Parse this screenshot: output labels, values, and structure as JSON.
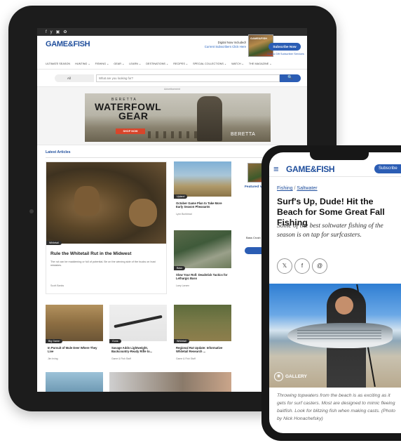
{
  "tablet": {
    "social_icons": [
      "f",
      "y",
      "▣",
      "✿"
    ],
    "logo": "GAME&FISH",
    "digital_line1": "Digital Now Included!",
    "digital_line2": "Current Subscribers Click Here",
    "mag_label": "GAME&FISH",
    "subscribe_label": "Subscribe Now",
    "header_links": "Give a Gift   Subscriber Services",
    "nav_items": [
      "ULTIMATE SEASON",
      "HUNTING ⌄",
      "FISHING ⌄",
      "GEAR ⌄",
      "LEARN ⌄",
      "DESTINATIONS ⌄",
      "RECIPES ⌄",
      "SPECIAL COLLECTIONS ⌄",
      "WATCH ⌄",
      "THE MAGAZINE ⌄"
    ],
    "search_category": "All",
    "search_placeholder": "What are you looking for?",
    "search_button": "🔍",
    "ad_label": "Advertisement",
    "ad_brand_small": "BERETTA",
    "ad_line1": "WATERFOWL",
    "ad_line2": "GEAR",
    "ad_button": "SHOP NOW",
    "ad_brand_mark": "BERETTA",
    "section_title": "Latest Articles",
    "main_article": {
      "tag": "Whitetail",
      "title": "Rule the Whitetail Rut in the Midwest",
      "description": "The rut can be maddening or full of potential. Be on the winning side of the bucks on bust mistakes.",
      "byline": "Scott Banks"
    },
    "right_cards": [
      {
        "tag": "Upland",
        "title": "October Game Plan to Take More Early Season Pheasants",
        "byline": "Lynn Burkhead"
      },
      {
        "tag": "Bass",
        "title": "Slow Your Roll: Deadstick Tactics for Lethargic Bass",
        "byline": "Larry Larsen"
      }
    ],
    "bottom_cards": [
      {
        "tag": "Big Game",
        "title": "In Pursuit of Mule Deer Where They Live",
        "byline": "Jim Irving"
      },
      {
        "tag": "Guns",
        "title": "Savage Adds Lightweight, Backcountry-Ready Rifle to...",
        "byline": "Game & Fish Staff"
      },
      {
        "tag": "Whitetail",
        "title": "Regional Rut Update: Informative Whitetail Research ...",
        "byline": "Game & Fish Staff"
      }
    ],
    "side_column": {
      "featured_label": "Featured Vide",
      "promo_title": "Bass Crush Coun Bladed Jigs",
      "see_label": "See"
    }
  },
  "phone": {
    "menu_icon": "≡",
    "logo": "GAME&FISH",
    "subscribe_label": "Subscribe",
    "crumb_1": "Fishing",
    "crumb_sep": " / ",
    "crumb_2": "Saltwater",
    "title": "Surf's Up, Dude! Hit the Beach for Some Great Fall Fishing",
    "deck": "Some of the best soltwater fishing of the season is on tap for surfcasters.",
    "share_icons": [
      "𝕏",
      "f",
      "@"
    ],
    "gallery_icon": "◉",
    "gallery_label": "GALLERY",
    "caption": "Throwing topwaters from the beach is as exciting as it gets for surf casters. Most are designed to mimic fleeing baitfish. Look for blitzing fish when making casts. (Photo by Nick Honachefsky)"
  }
}
